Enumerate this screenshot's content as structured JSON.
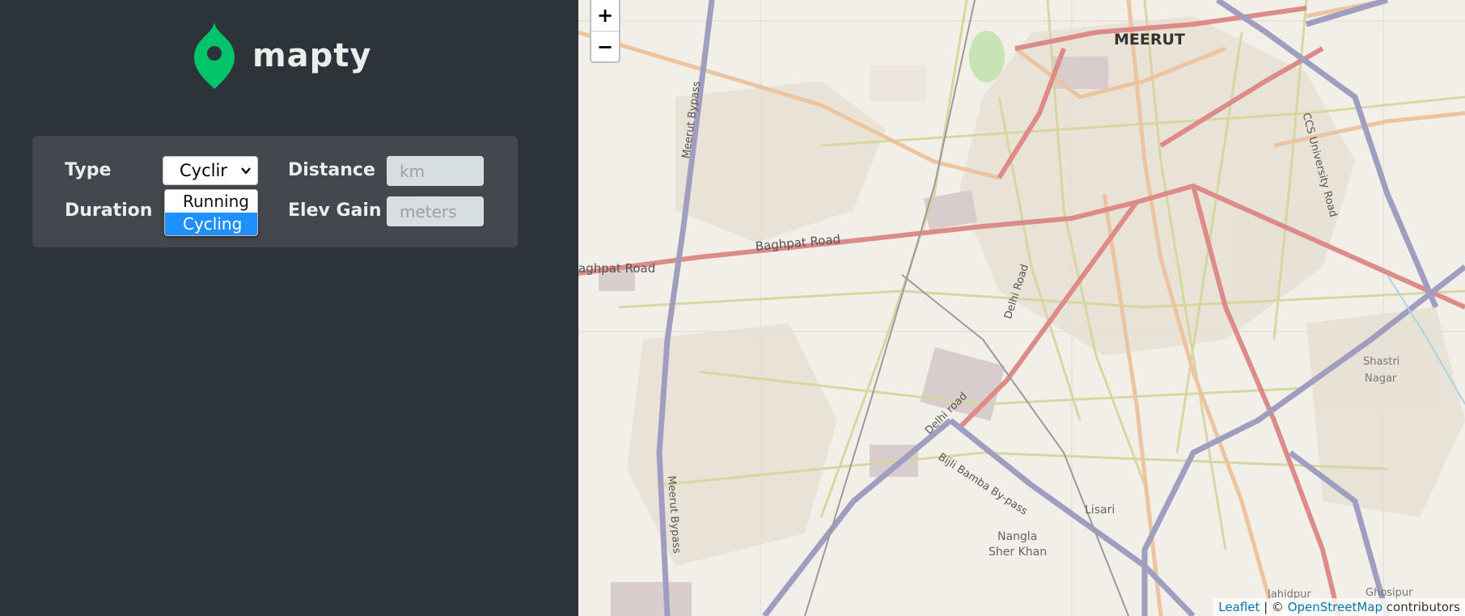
{
  "app": {
    "name": "mapty",
    "accent_color": "#00c46a"
  },
  "form": {
    "type_label": "Type",
    "type_value": "Cyclir",
    "type_options": [
      "Running",
      "Cycling"
    ],
    "type_selected_option": "Cycling",
    "distance_label": "Distance",
    "distance_placeholder": "km",
    "duration_label": "Duration",
    "elev_label": "Elev Gain",
    "elev_placeholder": "meters"
  },
  "map": {
    "zoom_in": "+",
    "zoom_out": "−",
    "attribution": {
      "leaflet": "Leaflet",
      "separator": " | © ",
      "osm": "OpenStreetMap",
      "suffix": " contributors"
    },
    "labels": {
      "city": "MEERUT",
      "baghpat_road_left": "aghpat Road",
      "baghpat_road": "Baghpat Road",
      "meerut_bypass_top": "Meerut Bypass",
      "meerut_bypass_bottom": "Meerut Bypass",
      "delhi_road_top": "Delhi Road",
      "delhi_road_bottom": "Delhi road",
      "bijli_bamba": "Bijli Bamba By-pass",
      "ccs_road": "CCS University Road",
      "nangla_1": "Nangla",
      "nangla_2": "Sher Khan",
      "lisari": "Lisari",
      "shastri_1": "Shastri",
      "shastri_2": "Nagar",
      "jahidpur": "Jahidpur",
      "ghosipur": "Ghosipur"
    }
  }
}
